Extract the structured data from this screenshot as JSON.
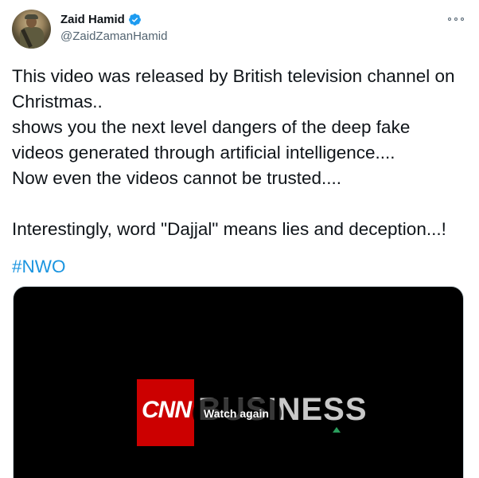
{
  "author": {
    "name": "Zaid Hamid",
    "handle": "@ZaidZamanHamid",
    "verified_color": "#1d9bf0"
  },
  "tweet": {
    "lines": [
      "This video was released by British television channel on",
      "Christmas..",
      "shows you the next level dangers of the deep fake",
      "videos generated through artificial intelligence....",
      "Now even the videos cannot be trusted....",
      "",
      "Interestingly, word \"Dajjal\" means lies and deception...!"
    ],
    "hashtag": "#NWO"
  },
  "video": {
    "logo_left": "CNN",
    "logo_right": "BUSINESS",
    "watch_label": "Watch again"
  },
  "colors": {
    "text": "#0f1419",
    "secondary": "#536471",
    "link": "#1b95e0",
    "cnn_red": "#cc0000"
  }
}
